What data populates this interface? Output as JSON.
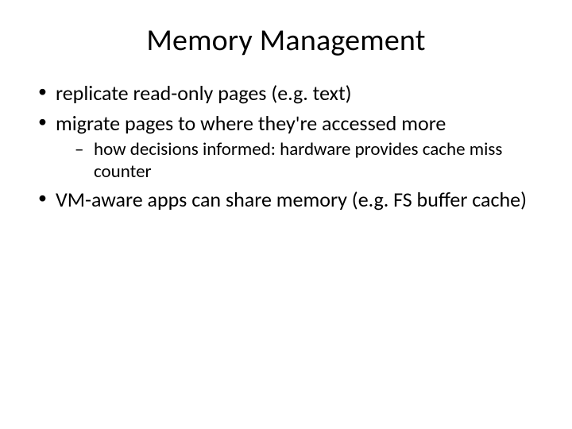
{
  "title": "Memory Management",
  "bullets": [
    {
      "text": "replicate read-only pages (e.g. text)"
    },
    {
      "text": "migrate pages to where they're accessed more",
      "sub": [
        {
          "text": "how decisions informed: hardware provides cache miss counter"
        }
      ]
    },
    {
      "text": "VM-aware apps can share memory (e.g. FS buffer cache)"
    }
  ]
}
